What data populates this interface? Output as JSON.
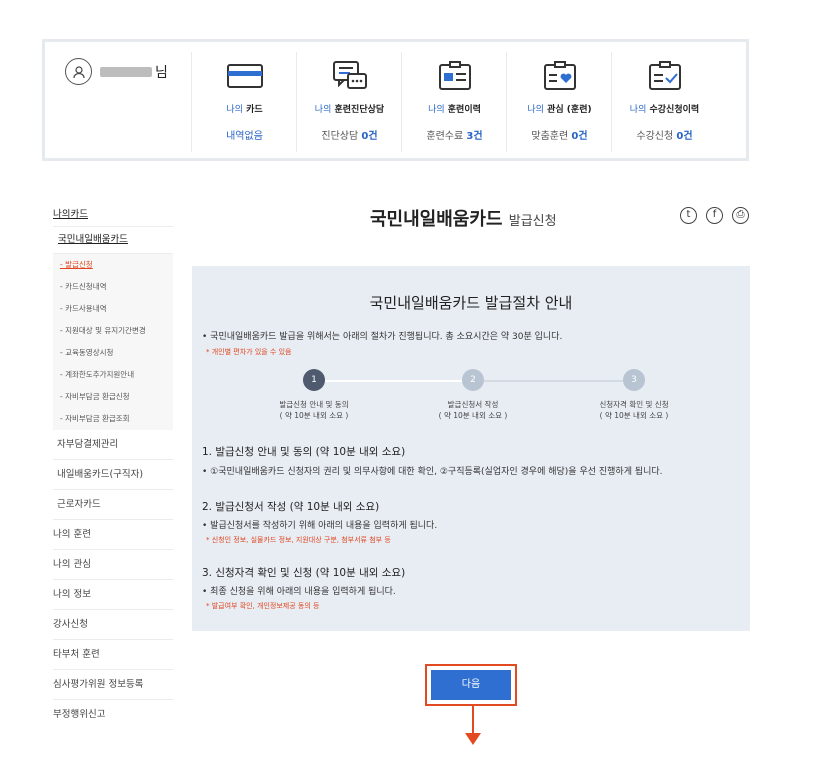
{
  "user": {
    "suffix": "님"
  },
  "summary": [
    {
      "label_blue": "나의",
      "label": "카드",
      "value_prefix": "",
      "value_num": "내역없음",
      "icon": "card-icon"
    },
    {
      "label_blue": "나의",
      "label": "훈련진단상담",
      "value_prefix": "진단상담",
      "value_num": "0건",
      "icon": "chat-icon"
    },
    {
      "label_blue": "나의",
      "label": "훈련이력",
      "value_prefix": "훈련수료",
      "value_num": "3건",
      "icon": "history-icon"
    },
    {
      "label_blue": "나의",
      "label": "관심 (훈련)",
      "value_prefix": "맞춤훈련",
      "value_num": "0건",
      "icon": "heart-icon"
    },
    {
      "label_blue": "나의",
      "label": "수강신청이력",
      "value_prefix": "수강신청",
      "value_num": "0건",
      "icon": "check-icon"
    }
  ],
  "nav": {
    "top": "나의카드",
    "sub": "국민내일배움카드",
    "sub2": [
      "- 발급신청",
      "- 카드신청내역",
      "- 카드사용내역",
      "- 지원대상 및 유지기간변경",
      "- 교육동영상시청",
      "- 계좌한도추가지원안내",
      "- 자비부담금 환급신청",
      "- 자비부담금 환급조회"
    ],
    "indented": [
      "자부담결제관리",
      "내일배움카드(구직자)",
      "근로자카드"
    ],
    "items": [
      "나의 훈련",
      "나의 관심",
      "나의 정보",
      "강사신청",
      "타부처 훈련",
      "심사평가위원 정보등록",
      "부정행위신고"
    ]
  },
  "page": {
    "title": "국민내일배움카드",
    "title_small": "발급신청"
  },
  "share": {
    "twitter": "t",
    "facebook": "f",
    "print": "⎙"
  },
  "guide": {
    "title": "국민내일배움카드 발급절차 안내",
    "intro": "• 국민내일배움카드 발급을 위해서는 아래의 절차가 진행됩니다. 총 소요시간은 약 30분 입니다.",
    "intro_note": "* 개인별 편차가 있을 수 있음",
    "steps": [
      {
        "num": "1",
        "label": "발급신청 안내 및 동의",
        "time": "( 약 10분 내외 소요 )"
      },
      {
        "num": "2",
        "label": "발급신청서 작성",
        "time": "( 약 10분 내외 소요 )"
      },
      {
        "num": "3",
        "label": "신청자격 확인 및 신청",
        "time": "( 약 10분 내외 소요 )"
      }
    ],
    "sections": [
      {
        "head": "1. 발급신청 안내 및 동의 (약 10분 내외 소요)",
        "desc": "• ①국민내일배움카드 신청자의 권리 및 의무사항에 대한 확인, ②구직등록(실업자인 경우에 해당)을 우선 진행하게 됩니다.",
        "note": ""
      },
      {
        "head": "2. 발급신청서 작성 (약 10분 내외 소요)",
        "desc": "• 발급신청서를 작성하기 위해 아래의 내용을 입력하게 됩니다.",
        "note": "* 신청인 정보, 실물카드 정보, 지원대상 구분, 첨부서류 첨부 등"
      },
      {
        "head": "3. 신청자격 확인 및 신청 (약 10분 내외 소요)",
        "desc": "• 최종 신청을 위해 아래의 내용을 입력하게 됩니다.",
        "note": "* 발급여부 확인, 개인정보제공 동의 등"
      }
    ]
  },
  "next_button": "다음"
}
